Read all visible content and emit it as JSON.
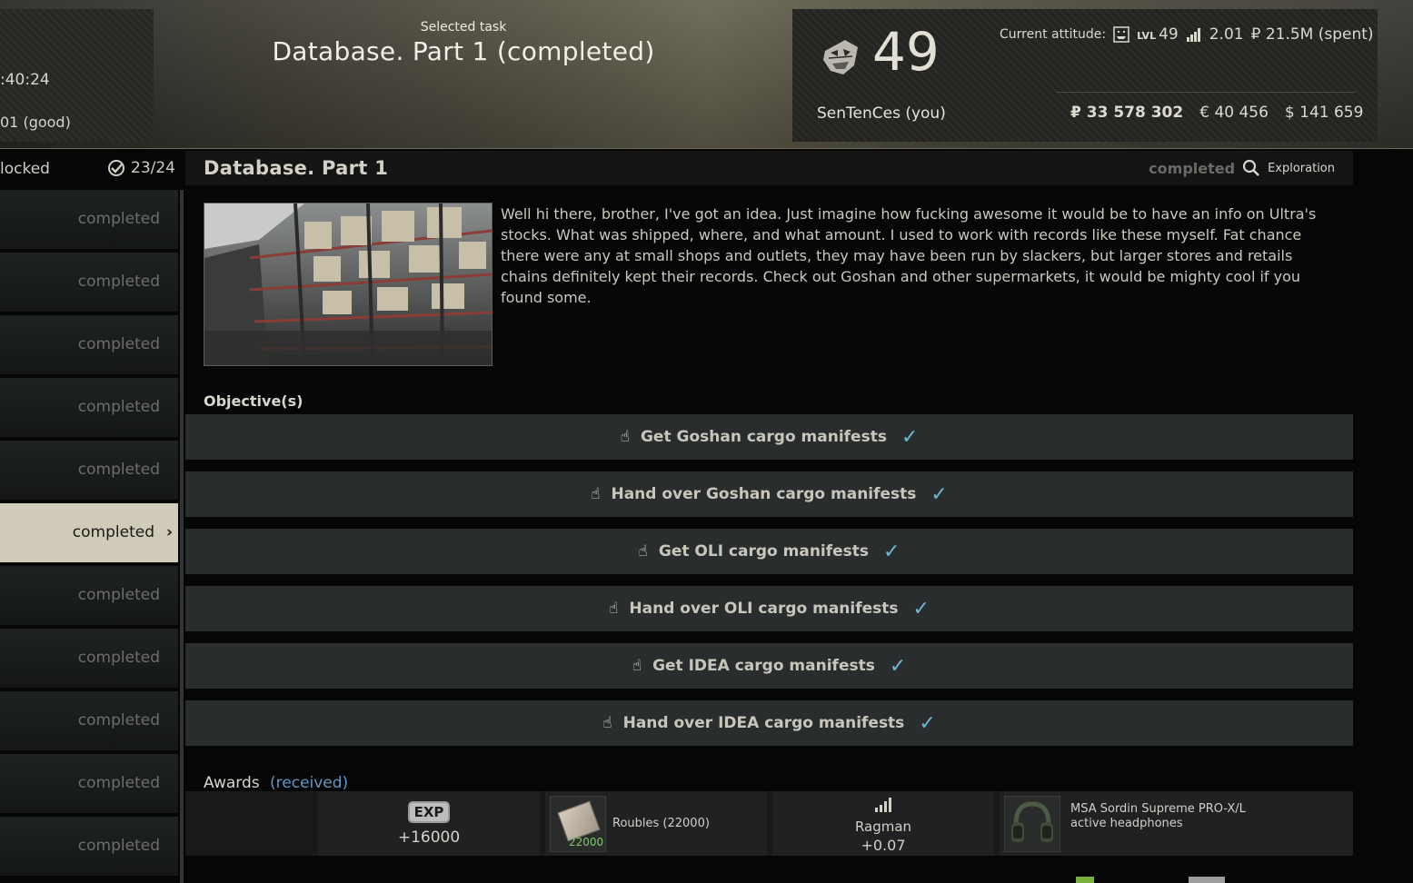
{
  "header": {
    "left_time": ":40:24",
    "left_standing": "01 (good)",
    "selected_task_label": "Selected task",
    "selected_task_title": "Database. Part 1 (completed)"
  },
  "trader": {
    "level": "49",
    "player_name": "SenTenCes (you)",
    "attitude_label": "Current attitude:",
    "lvl_prefix": "LVL",
    "lvl": "49",
    "standing": "2.01",
    "spent": "₽ 21.5M (spent)",
    "roubles": "₽ 33 578 302",
    "euros": "€ 40 456",
    "dollars": "$ 141 659"
  },
  "sidebar": {
    "status_text": "locked",
    "count": "23/24",
    "items": [
      {
        "label": "completed"
      },
      {
        "label": "completed"
      },
      {
        "label": "completed"
      },
      {
        "label": "completed"
      },
      {
        "label": "completed"
      },
      {
        "label": "completed",
        "selected": true
      },
      {
        "label": "completed"
      },
      {
        "label": "completed"
      },
      {
        "label": "completed"
      },
      {
        "label": "completed"
      },
      {
        "label": "completed"
      }
    ]
  },
  "task": {
    "title": "Database. Part 1",
    "status": "completed",
    "type": "Exploration",
    "description": "Well hi there, brother, I've got an idea. Just imagine how fucking awesome it would be to have an info on Ultra's stocks. What was shipped, where, and what amount. I used to work with records like these myself. Fat chance there were any at small shops and outlets, they may have been run by slackers, but larger stores and retails chains definitely kept their records. Check out Goshan and other supermarkets, it would be mighty cool if you found some.",
    "objectives_label": "Objective(s)",
    "objectives": [
      {
        "text": "Get Goshan cargo manifests"
      },
      {
        "text": "Hand over Goshan cargo manifests"
      },
      {
        "text": "Get OLI cargo manifests"
      },
      {
        "text": "Hand over OLI cargo manifests"
      },
      {
        "text": "Get IDEA cargo manifests"
      },
      {
        "text": "Hand over IDEA cargo manifests"
      }
    ]
  },
  "awards": {
    "label": "Awards",
    "received": "(received)",
    "exp_badge": "EXP",
    "exp_value": "+16000",
    "roubles_thumb": "22000",
    "roubles_label": "Roubles (22000)",
    "ragman_name": "Ragman",
    "ragman_value": "+0.07",
    "headphones_label": "MSA Sordin Supreme PRO-X/L active headphones"
  },
  "colors": {
    "accent_check": "#6fb7d6",
    "received_link": "#5d99c3",
    "selected_item_bg": "#cfcbb8"
  }
}
